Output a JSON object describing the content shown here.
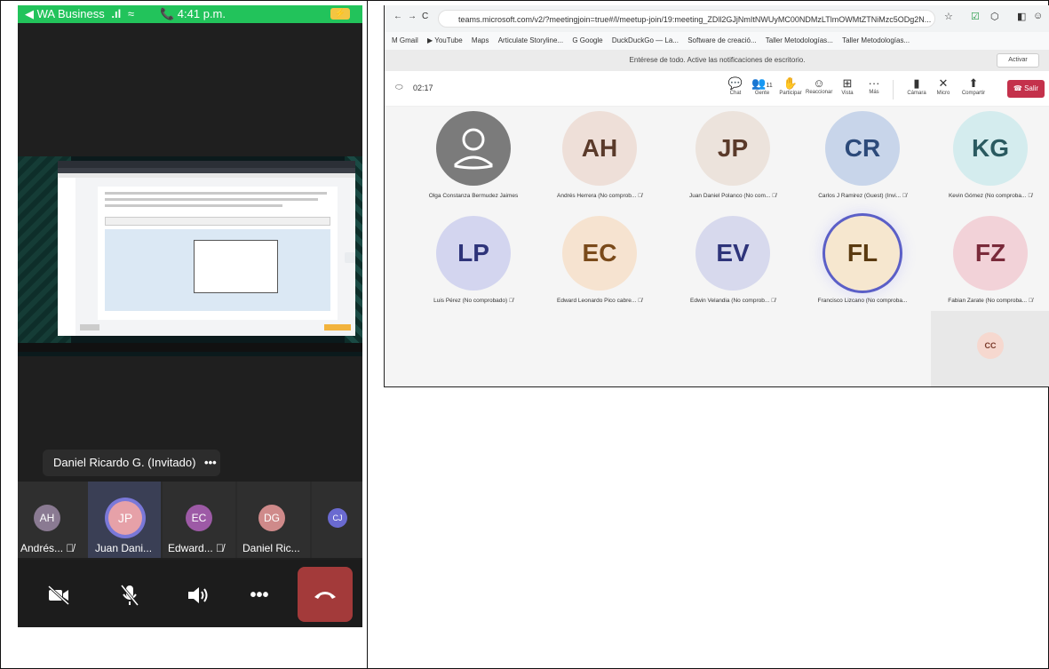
{
  "phone": {
    "status": {
      "back_label": "◀ WA Business",
      "signal": ".ıl",
      "wifi": "≈",
      "time": "📞 4:41 p.m.",
      "battery": "⚡"
    },
    "speaker_label": "Daniel Ricardo G. (Invitado)",
    "speaker_more": "•••",
    "roster": [
      {
        "initials": "AH",
        "name": "Andrés...",
        "color": "#8a7a92",
        "muted": true
      },
      {
        "initials": "JP",
        "name": "Juan Dani...",
        "color": "#e6a1a8",
        "muted": false
      },
      {
        "initials": "EC",
        "name": "Edward...",
        "color": "#9d5aa6",
        "muted": true
      },
      {
        "initials": "DG",
        "name": "Daniel Ric...",
        "color": "#cf8a8a",
        "muted": false
      },
      {
        "initials": "CJ",
        "name": "",
        "color": "#6a6ad0",
        "muted": false
      }
    ],
    "controls": {
      "camera": "camera-off-icon",
      "mic": "mic-off-icon",
      "speaker": "speaker-icon",
      "more": "•••",
      "hangup": "hang-up-icon"
    }
  },
  "teams": {
    "nav": {
      "back": "←",
      "forward": "→",
      "reload": "C"
    },
    "url": "teams.microsoft.com/v2/?meetingjoin=true#/l/meetup-join/19:meeting_ZDll2GJjNmItNWUyMC00NDMzLTlmOWMtZTNiMzc5ODg2N...",
    "bookmarks": [
      "M Gmail",
      "▶ YouTube",
      "Maps",
      "Articulate Storyline...",
      "G Google",
      "DuckDuckGo — La...",
      "Software de creació...",
      "Taller Metodologías...",
      "Taller Metodologías..."
    ],
    "notification": "Entérese de todo. Active las notificaciones de escritorio.",
    "notification_button": "Activar",
    "timer": "02:17",
    "toolbar": [
      {
        "label": "Chat",
        "icon": "💬"
      },
      {
        "label": "Gente",
        "icon": "👥"
      },
      {
        "label": "Participar",
        "icon": "✋"
      },
      {
        "label": "Reaccionar",
        "icon": "☺"
      },
      {
        "label": "Vista",
        "icon": "⊞"
      },
      {
        "label": "Más",
        "icon": "···"
      },
      {
        "label": "Cámara",
        "icon": "▮"
      },
      {
        "label": "Micro",
        "icon": "✕"
      },
      {
        "label": "Compartir",
        "icon": "⬆"
      }
    ],
    "people_count": "11",
    "leave_label": "Salir",
    "participants": [
      {
        "initials": "",
        "name": "Olga Constanza Bermudez Jaimes",
        "bg": "#7b7b7b",
        "fg": "#ffffff"
      },
      {
        "initials": "AH",
        "name": "Andrés Herrera (No comprob...",
        "bg": "#eedfd8",
        "fg": "#5a3a2a"
      },
      {
        "initials": "JP",
        "name": "Juan Daniel Polanco (No com...",
        "bg": "#ece3dc",
        "fg": "#5a3a2a"
      },
      {
        "initials": "CR",
        "name": "Carlos J Ramirez (Guest) (Invi...",
        "bg": "#c8d5ea",
        "fg": "#2c4a7a"
      },
      {
        "initials": "KG",
        "name": "Kevin Gómez (No comproba...",
        "bg": "#d4ecee",
        "fg": "#2a5a60"
      },
      {
        "initials": "LP",
        "name": "Luis Pérez (No comprobado)",
        "bg": "#d3d5ef",
        "fg": "#2e347a"
      },
      {
        "initials": "EC",
        "name": "Edward Leonardo Pico cabre...",
        "bg": "#f6e3d0",
        "fg": "#7a4a1a"
      },
      {
        "initials": "EV",
        "name": "Edwin Velandia (No comprob...",
        "bg": "#d7d9ed",
        "fg": "#2e347a"
      },
      {
        "initials": "FL",
        "name": "Francisco Lizcano (No comproba...",
        "bg": "#f6e7cf",
        "fg": "#5a3a10"
      },
      {
        "initials": "FZ",
        "name": "Fabian Zarate (No comproba...",
        "bg": "#f2d2d8",
        "fg": "#7a2a3a"
      }
    ],
    "self_tile": "CC"
  }
}
